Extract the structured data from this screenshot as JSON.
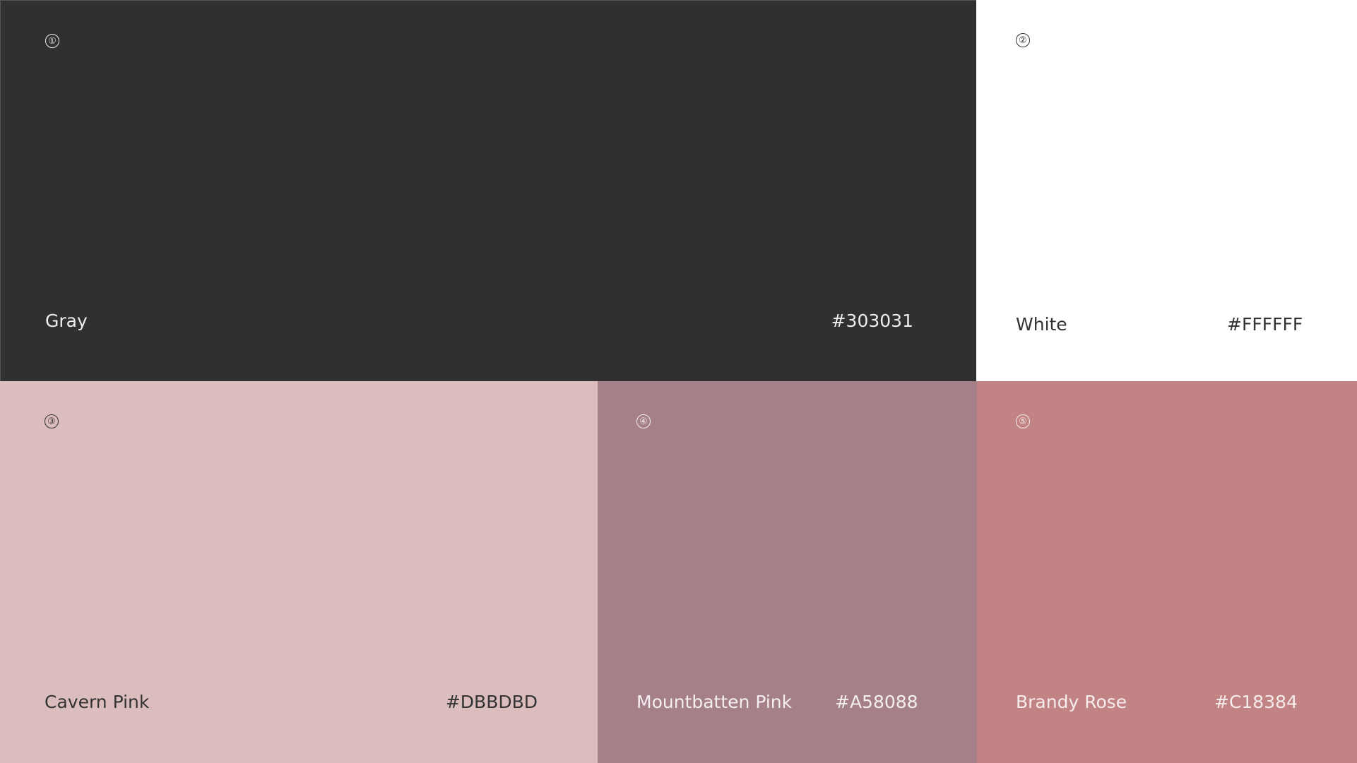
{
  "swatches": [
    {
      "index": "①",
      "name": "Gray",
      "hex": "#303031",
      "color": "#303031"
    },
    {
      "index": "②",
      "name": "White",
      "hex": "#FFFFFF",
      "color": "#FFFFFF"
    },
    {
      "index": "③",
      "name": "Cavern Pink",
      "hex": "#DBBDBD",
      "color": "#DBBDBD"
    },
    {
      "index": "④",
      "name": "Mountbatten Pink",
      "hex": "#A58088",
      "color": "#A58088"
    },
    {
      "index": "⑤",
      "name": "Brandy Rose",
      "hex": "#C18384",
      "color": "#C18384"
    }
  ]
}
